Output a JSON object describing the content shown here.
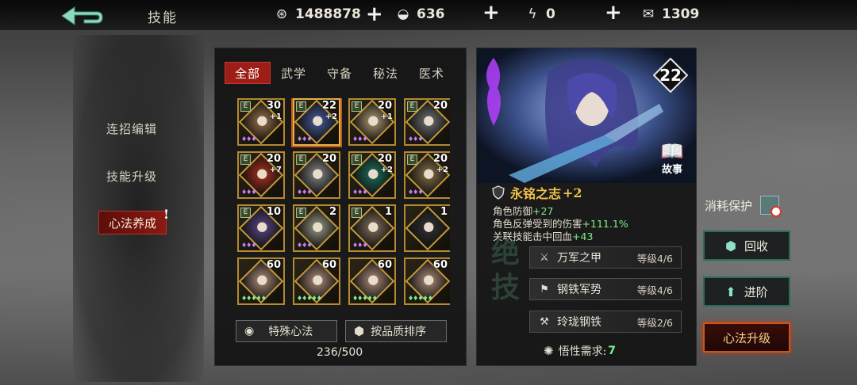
{
  "header": {
    "title": "技能",
    "currencies": [
      {
        "icon": "coin-icon",
        "value": "1488878"
      },
      {
        "icon": "silver-ingot-icon",
        "value": "636"
      },
      {
        "icon": "lightning-icon",
        "value": "0"
      },
      {
        "icon": "ticket-icon",
        "value": "1309"
      }
    ]
  },
  "leftnav": {
    "items": [
      "连招编辑",
      "技能升级"
    ],
    "active": "心法养成"
  },
  "tabs": [
    "全部",
    "武学",
    "守备",
    "秘法",
    "医术"
  ],
  "cards": [
    {
      "level": "30",
      "plus": "+1",
      "e": true,
      "gems": "♦♦♦",
      "tone": "#7a5a3a"
    },
    {
      "level": "22",
      "plus": "+2",
      "e": true,
      "gems": "♦♦♦",
      "tone": "#3a4a7a",
      "selected": true
    },
    {
      "level": "20",
      "plus": "+1",
      "e": true,
      "gems": "♦♦♦",
      "tone": "#8a7a5a"
    },
    {
      "level": "20",
      "plus": "",
      "e": true,
      "gems": "♦♦♦",
      "tone": "#5a5a5a"
    },
    {
      "level": "20",
      "plus": "+7",
      "e": true,
      "gems": "♦♦♦",
      "tone": "#8a2a1a"
    },
    {
      "level": "20",
      "plus": "",
      "e": true,
      "gems": "♦♦♦",
      "tone": "#6a6a6a"
    },
    {
      "level": "20",
      "plus": "+2",
      "e": true,
      "gems": "♦♦♦",
      "tone": "#1a5a4a"
    },
    {
      "level": "20",
      "plus": "+2",
      "e": true,
      "gems": "♦♦♦",
      "tone": "#6a5a3a"
    },
    {
      "level": "10",
      "plus": "",
      "e": true,
      "gems": "♦♦♦",
      "tone": "#4a3a6a"
    },
    {
      "level": "2",
      "plus": "",
      "e": true,
      "gems": "♦♦♦",
      "tone": "#7a7a6a"
    },
    {
      "level": "1",
      "plus": "",
      "e": true,
      "gems": "♦♦♦",
      "tone": "#6a5a4a"
    },
    {
      "level": "1",
      "plus": "",
      "e": false,
      "gems": "",
      "tone": "#2a2a2a"
    },
    {
      "level": "60",
      "plus": "",
      "e": false,
      "gems": "♦♦♦♦♦",
      "tone": "#8a7060",
      "green": true
    },
    {
      "level": "60",
      "plus": "",
      "e": false,
      "gems": "♦♦♦♦♦",
      "tone": "#8a7060",
      "green": true
    },
    {
      "level": "60",
      "plus": "",
      "e": false,
      "gems": "♦♦♦♦♦",
      "tone": "#8a7060",
      "green": true
    },
    {
      "level": "60",
      "plus": "",
      "e": false,
      "gems": "♦♦♦♦♦",
      "tone": "#8a7060",
      "green": true
    }
  ],
  "buttons": {
    "special": "特殊心法",
    "sort": "按品质排序"
  },
  "count": "236/500",
  "detail": {
    "level": "22",
    "story": "故事",
    "name": "永铭之志",
    "name_plus": "+2",
    "stats": [
      {
        "label": "角色防御",
        "value": "+27"
      },
      {
        "label": "角色反弹受到的伤害",
        "value": "+111.1%"
      },
      {
        "label": "关联技能击中回血",
        "value": "+43"
      }
    ],
    "jueji": "绝技",
    "subskills": [
      {
        "name": "万军之甲",
        "level": "等级4/6"
      },
      {
        "name": "钢铁军势",
        "level": "等级4/6"
      },
      {
        "name": "玲珑钢铁",
        "level": "等级2/6"
      }
    ],
    "requirement_label": "悟性需求:",
    "requirement_value": "7"
  },
  "right": {
    "protect": "消耗保护",
    "recycle": "回收",
    "advance": "进阶",
    "upgrade": "心法升级"
  },
  "colors": {
    "accent_red": "#9e1d17",
    "gold": "#b38a2e",
    "green": "#7ff08a"
  }
}
